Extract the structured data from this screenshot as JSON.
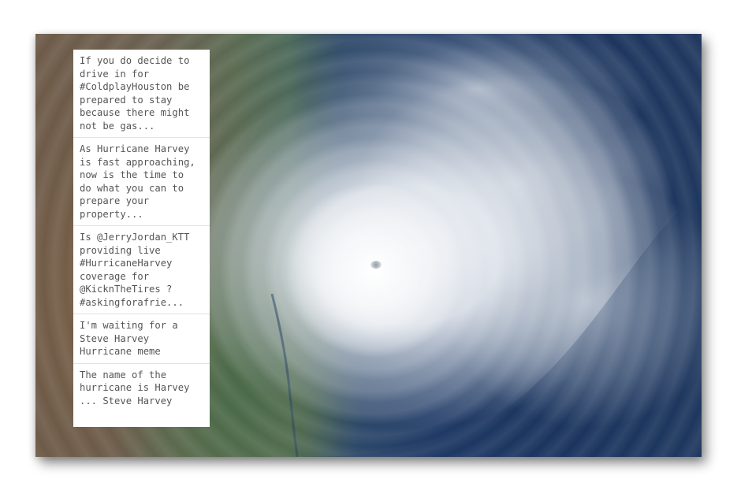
{
  "image": {
    "subject": "satellite-image",
    "colors": {
      "ocean": "#1f3a66",
      "land": "#6e5a48",
      "cloud": "#f4f6f8"
    }
  },
  "tweets": [
    {
      "text": "If you do decide to\ndrive in for\n#ColdplayHouston be\nprepared to stay\nbecause there might\nnot be gas..."
    },
    {
      "text": "As Hurricane Harvey\nis fast approaching,\nnow is the time to\ndo what you can to\nprepare your\nproperty..."
    },
    {
      "text": "Is @JerryJordan_KTT\nproviding live\n#HurricaneHarvey\ncoverage for\n@KicknTheTires ?\n#askingforafrie..."
    },
    {
      "text": "I'm waiting for a\nSteve Harvey\nHurricane meme"
    },
    {
      "text": "The name of the\nhurricane is Harvey\n... Steve Harvey"
    }
  ]
}
